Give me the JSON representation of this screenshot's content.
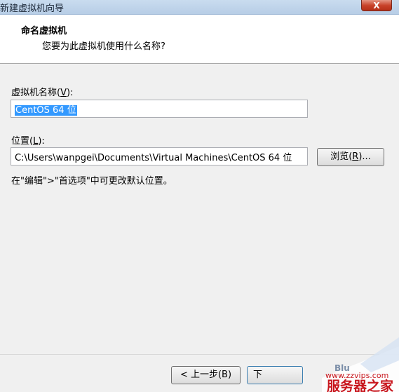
{
  "window": {
    "title": "新建虚拟机向导",
    "close_label": "X"
  },
  "header": {
    "heading": "命名虚拟机",
    "subheading": "您要为此虚拟机使用什么名称?"
  },
  "form": {
    "name_label": "虚拟机名称(",
    "name_accel": "V",
    "name_label_end": "):",
    "name_value": "CentOS 64 位",
    "location_label": "位置(",
    "location_accel": "L",
    "location_label_end": "):",
    "location_value": "C:\\Users\\wanpgei\\Documents\\Virtual Machines\\CentOS 64 位",
    "browse_label": "浏览(",
    "browse_accel": "R",
    "browse_label_end": ")...",
    "hint": "在\"编辑\">\"首选项\"中可更改默认位置。"
  },
  "footer": {
    "back_label": "< 上一步(B)",
    "next_label": "下"
  },
  "watermark": {
    "url": "www.zzvips.com",
    "brand": "服务器之家",
    "fragment": "Blu"
  },
  "colors": {
    "selection": "#3399ff",
    "watermark_red": "#c8161d"
  }
}
